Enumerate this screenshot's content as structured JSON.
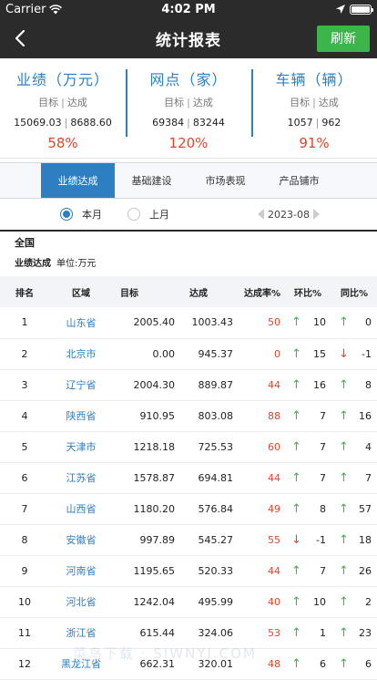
{
  "status_bar": {
    "carrier": "Carrier",
    "time": "4:02 PM"
  },
  "nav": {
    "title": "统计报表",
    "refresh_label": "刷新"
  },
  "summary": [
    {
      "title": "业绩（万元）",
      "label_target": "目标",
      "label_actual": "达成",
      "target": "15069.03",
      "actual": "8688.60",
      "pct": "58%"
    },
    {
      "title": "网点（家）",
      "label_target": "目标",
      "label_actual": "达成",
      "target": "69384",
      "actual": "83244",
      "pct": "120%"
    },
    {
      "title": "车辆（辆）",
      "label_target": "目标",
      "label_actual": "达成",
      "target": "1057",
      "actual": "962",
      "pct": "91%"
    }
  ],
  "tabs": [
    {
      "label": "业绩达成",
      "active": true
    },
    {
      "label": "基础建设",
      "active": false
    },
    {
      "label": "市场表现",
      "active": false
    },
    {
      "label": "产品铺市",
      "active": false
    }
  ],
  "filters": {
    "this_month": "本月",
    "last_month": "上月",
    "selected": "本月",
    "date": "2023-08"
  },
  "region_label": "全国",
  "section": {
    "title": "业绩达成",
    "unit": "单位:万元"
  },
  "table": {
    "headers": [
      "排名",
      "区域",
      "目标",
      "达成",
      "达成率%",
      "环比%",
      "同比%"
    ],
    "rows": [
      {
        "rank": "1",
        "area": "山东省",
        "target": "2005.40",
        "actual": "1003.43",
        "rate": "50",
        "hb_dir": "up",
        "hb": "10",
        "tb_dir": "up",
        "tb": "0"
      },
      {
        "rank": "2",
        "area": "北京市",
        "target": "0.00",
        "actual": "945.37",
        "rate": "0",
        "hb_dir": "up",
        "hb": "15",
        "tb_dir": "down",
        "tb": "-1"
      },
      {
        "rank": "3",
        "area": "辽宁省",
        "target": "2004.30",
        "actual": "889.87",
        "rate": "44",
        "hb_dir": "up",
        "hb": "16",
        "tb_dir": "up",
        "tb": "8"
      },
      {
        "rank": "4",
        "area": "陕西省",
        "target": "910.95",
        "actual": "803.08",
        "rate": "88",
        "hb_dir": "up",
        "hb": "7",
        "tb_dir": "up",
        "tb": "16"
      },
      {
        "rank": "5",
        "area": "天津市",
        "target": "1218.18",
        "actual": "725.53",
        "rate": "60",
        "hb_dir": "up",
        "hb": "7",
        "tb_dir": "up",
        "tb": "4"
      },
      {
        "rank": "6",
        "area": "江苏省",
        "target": "1578.87",
        "actual": "694.81",
        "rate": "44",
        "hb_dir": "up",
        "hb": "7",
        "tb_dir": "up",
        "tb": "7"
      },
      {
        "rank": "7",
        "area": "山西省",
        "target": "1180.20",
        "actual": "576.84",
        "rate": "49",
        "hb_dir": "up",
        "hb": "8",
        "tb_dir": "up",
        "tb": "57"
      },
      {
        "rank": "8",
        "area": "安徽省",
        "target": "997.89",
        "actual": "545.27",
        "rate": "55",
        "hb_dir": "down",
        "hb": "-1",
        "tb_dir": "up",
        "tb": "18"
      },
      {
        "rank": "9",
        "area": "河南省",
        "target": "1195.65",
        "actual": "520.33",
        "rate": "44",
        "hb_dir": "up",
        "hb": "7",
        "tb_dir": "up",
        "tb": "26"
      },
      {
        "rank": "10",
        "area": "河北省",
        "target": "1242.04",
        "actual": "495.99",
        "rate": "40",
        "hb_dir": "up",
        "hb": "10",
        "tb_dir": "up",
        "tb": "2"
      },
      {
        "rank": "11",
        "area": "浙江省",
        "target": "615.44",
        "actual": "324.06",
        "rate": "53",
        "hb_dir": "up",
        "hb": "1",
        "tb_dir": "up",
        "tb": "23"
      },
      {
        "rank": "12",
        "area": "黑龙江省",
        "target": "662.31",
        "actual": "320.01",
        "rate": "48",
        "hb_dir": "up",
        "hb": "6",
        "tb_dir": "up",
        "tb": "6"
      }
    ]
  },
  "watermark": "菜鸟下载 · SIWNYI.COM",
  "colors": {
    "accent": "#2d7fc1",
    "positive": "#3cb54a",
    "negative": "#e2452b",
    "bar": "#2b2b2b"
  }
}
